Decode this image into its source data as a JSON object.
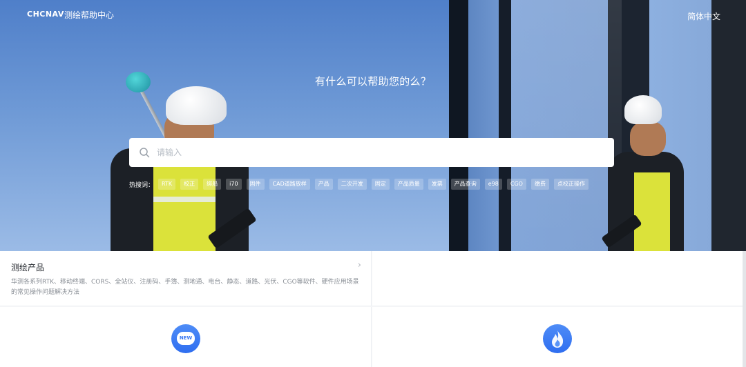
{
  "header": {
    "logo": "CHCNAV",
    "site_title": "测绘帮助中心",
    "language": "简体中文"
  },
  "hero": {
    "title": "有什么可以帮助您的么？",
    "search_placeholder": "请输入",
    "hot_label": "热搜词：",
    "hot_tags": [
      "RTK",
      "校正",
      "绑船",
      "i70",
      "固件",
      "CAD道路放样",
      "产品",
      "二次开发",
      "固定",
      "产品质量",
      "发票",
      "产品查询",
      "e98",
      "CGO",
      "缴费",
      "点校正操作"
    ]
  },
  "cards": [
    {
      "title": "测绘产品",
      "arrow": "›",
      "desc": "华测各系列RTK、移动终端、CORS、全站仪、注册码、手簿、测地通、电台、静态、道路、光伏、CGO等软件、硬件应用场景的常见操作问题解决方法"
    },
    {
      "title": ""
    },
    {
      "icon": "new-icon",
      "badge": "NEW"
    },
    {
      "icon": "fire-icon"
    }
  ],
  "colors": {
    "accent": "#2f6ef0",
    "hero_sky": "#6f9ad6"
  }
}
